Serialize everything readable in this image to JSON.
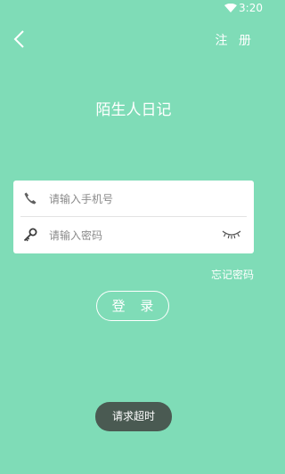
{
  "status_bar": {
    "time": "3:20",
    "wifi_icon": "wifi-icon"
  },
  "header": {
    "back_icon": "chevron-left-icon",
    "register_label": "注 册"
  },
  "app_title": "陌生人日记",
  "form": {
    "phone_placeholder": "请输入手机号",
    "phone_value": "",
    "phone_icon": "phone-icon",
    "password_placeholder": "请输入密码",
    "password_value": "",
    "password_icon": "key-icon",
    "toggle_visibility_icon": "eye-closed-icon"
  },
  "forgot_password_label": "忘记密码",
  "login_label": "登 录",
  "toast_message": "请求超时",
  "colors": {
    "background": "#7fdcb7",
    "card": "#ffffff",
    "toast": "#4a5a52"
  }
}
